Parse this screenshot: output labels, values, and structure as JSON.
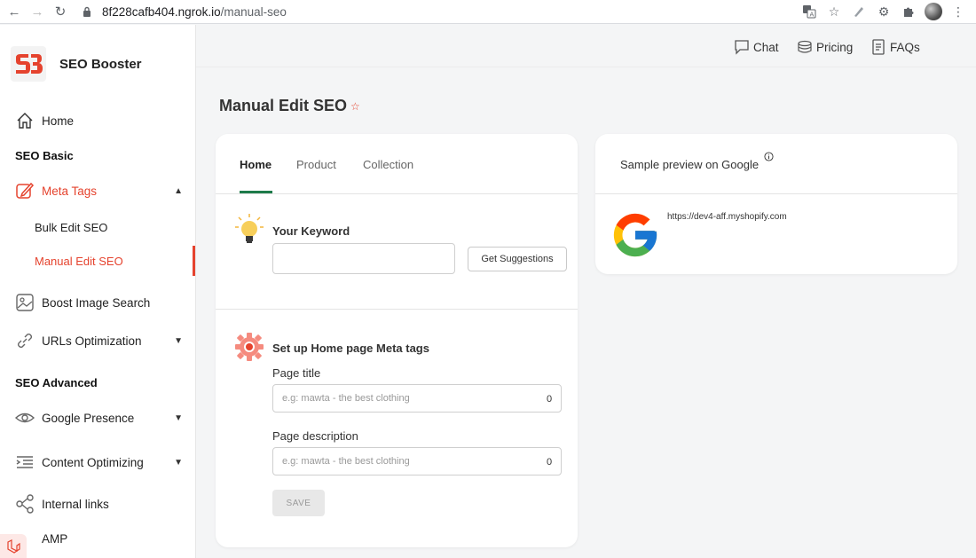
{
  "browser": {
    "url_host": "8f228cafb404.ngrok.io",
    "url_path": "/manual-seo"
  },
  "brand": {
    "name": "SEO Booster"
  },
  "sidebar": {
    "home": "Home",
    "section_basic": "SEO Basic",
    "meta_tags": "Meta Tags",
    "bulk_edit": "Bulk Edit SEO",
    "manual_edit": "Manual Edit SEO",
    "boost_image": "Boost Image Search",
    "urls_opt": "URLs Optimization",
    "section_advanced": "SEO Advanced",
    "google_presence": "Google Presence",
    "content_opt": "Content Optimizing",
    "internal_links": "Internal links",
    "amp": "AMP"
  },
  "topnav": {
    "chat": "Chat",
    "pricing": "Pricing",
    "faqs": "FAQs"
  },
  "page": {
    "title": "Manual Edit SEO"
  },
  "tabs": [
    "Home",
    "Product",
    "Collection"
  ],
  "keyword": {
    "label": "Your Keyword",
    "value": "",
    "suggest_button": "Get Suggestions"
  },
  "meta": {
    "heading": "Set up Home page Meta tags",
    "title_label": "Page title",
    "title_placeholder": "e.g: mawta - the best clothing",
    "title_count": "0",
    "desc_label": "Page description",
    "desc_placeholder": "e.g: mawta - the best clothing",
    "desc_count": "0",
    "save": "SAVE"
  },
  "preview": {
    "title": "Sample preview on Google",
    "url": "https://dev4-aff.myshopify.com"
  },
  "colors": {
    "accent": "#e5432e",
    "tab_active": "#1e7b4a"
  }
}
